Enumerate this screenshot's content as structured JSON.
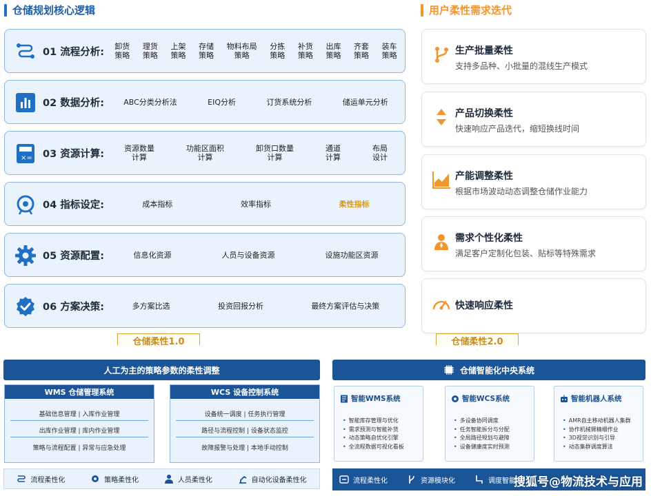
{
  "left_title": "仓储规划核心逻辑",
  "right_title": "用户柔性需求迭代",
  "steps": [
    {
      "label": "01 流程分析:",
      "icon": "flow-icon",
      "items": [
        "卸货\n策略",
        "理货\n策略",
        "上架\n策略",
        "存储\n策略",
        "物料布局\n策略",
        "分拣\n策略",
        "补货\n策略",
        "出库\n策略",
        "齐套\n策略",
        "装车\n策略"
      ]
    },
    {
      "label": "02 数据分析:",
      "icon": "bar-chart-icon",
      "items": [
        "ABC分类分析法",
        "EIQ分析",
        "订货系统分析",
        "储运单元分析"
      ]
    },
    {
      "label": "03 资源计算:",
      "icon": "calculator-icon",
      "items": [
        "资源数量\n计算",
        "功能区面积\n计算",
        "卸货口数量\n计算",
        "通道\n计算",
        "布局\n设计"
      ]
    },
    {
      "label": "04 指标设定:",
      "icon": "target-icon",
      "items": [
        "成本指标",
        "效率指标",
        "柔性指标"
      ]
    },
    {
      "label": "05 资源配置:",
      "icon": "gear-icon",
      "items": [
        "信息化资源",
        "人员与设备资源",
        "设施功能区资源"
      ]
    },
    {
      "label": "06 方案决策:",
      "icon": "check-badge-icon",
      "items": [
        "多方案比选",
        "投资回报分析",
        "最终方案评估与决策"
      ]
    }
  ],
  "cards": [
    {
      "title": "生产批量柔性",
      "desc": "支持多品种、小批量的混线生产模式",
      "icon": "branch-icon"
    },
    {
      "title": "产品切换柔性",
      "desc": "快速响应产品迭代，缩短换线时间",
      "icon": "switch-arrows-icon"
    },
    {
      "title": "产能调整柔性",
      "desc": "根据市场波动动态调整仓储作业能力",
      "icon": "area-chart-icon"
    },
    {
      "title": "需求个性化柔性",
      "desc": "满足客户定制化包装、贴标等特殊需求",
      "icon": "person-icon"
    },
    {
      "title": "快速响应柔性",
      "desc": "",
      "icon": "speedometer-icon"
    }
  ],
  "version1": "仓储柔性1.0",
  "version2": "仓储柔性2.0",
  "left_bottom": {
    "banner": "人工为主的策略参数的柔性调整",
    "wms": {
      "title": "WMS 仓储管理系统",
      "rows": [
        "基础信息管理 | 入库作业管理",
        "出库作业管理 | 库内作业管理",
        "策略与流程配置 | 异常与应急处理"
      ]
    },
    "wcs": {
      "title": "WCS 设备控制系统",
      "rows": [
        "设备统一调度 | 任务执行管理",
        "路径与流程控制 | 设备状态监控",
        "故障报警与处理 | 本地手动控制"
      ]
    },
    "footer": [
      "流程柔性化",
      "策略柔性化",
      "人员柔性化",
      "自动化设备柔性化"
    ]
  },
  "right_bottom": {
    "banner": "仓储智能化中央系统",
    "panels": [
      {
        "title": "智能WMS系统",
        "items": [
          "智能库存管理与优化",
          "需求预测与智能补货",
          "动态策略自优化引擎",
          "全流程数据可视化看板"
        ]
      },
      {
        "title": "智能WCS系统",
        "items": [
          "多设备协同调度",
          "任务智能拆分与分配",
          "全局路径规划与避障",
          "设备健康度实时预测"
        ]
      },
      {
        "title": "智能机器人系统",
        "items": [
          "AMR自主移动机器人集群",
          "协作机械臂精细作业",
          "3D视觉识别与引导",
          "动态集群调度算法"
        ]
      }
    ],
    "footer": [
      "流程柔性化",
      "资源模块化",
      "调度智能"
    ]
  },
  "watermark": "搜狐号@物流技术与应用",
  "colors": {
    "primary": "#1b5597",
    "accent_orange": "#f0962f",
    "highlight": "#d89a13",
    "panel_bg": "#eaf3fc"
  }
}
